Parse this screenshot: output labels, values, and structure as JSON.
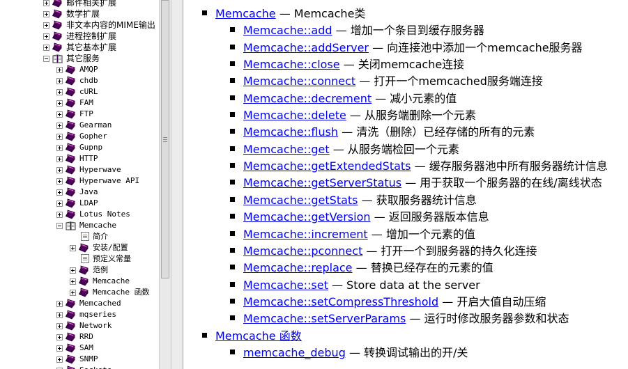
{
  "sidebar": {
    "items": [
      {
        "label": "邮件相关扩展",
        "expander": "plus",
        "icon": "book",
        "indent": 0
      },
      {
        "label": "数学扩展",
        "expander": "plus",
        "icon": "book",
        "indent": 0
      },
      {
        "label": "非文本内容的MIME输出",
        "expander": "plus",
        "icon": "book",
        "indent": 0
      },
      {
        "label": "进程控制扩展",
        "expander": "plus",
        "icon": "book",
        "indent": 0
      },
      {
        "label": "其它基本扩展",
        "expander": "plus",
        "icon": "book",
        "indent": 0
      },
      {
        "label": "其它服务",
        "expander": "minus",
        "icon": "book-open",
        "indent": 0
      },
      {
        "label": "AMQP",
        "expander": "plus",
        "icon": "book",
        "indent": 1
      },
      {
        "label": "chdb",
        "expander": "plus",
        "icon": "book",
        "indent": 1
      },
      {
        "label": "cURL",
        "expander": "plus",
        "icon": "book",
        "indent": 1
      },
      {
        "label": "FAM",
        "expander": "plus",
        "icon": "book",
        "indent": 1
      },
      {
        "label": "FTP",
        "expander": "plus",
        "icon": "book",
        "indent": 1
      },
      {
        "label": "Gearman",
        "expander": "plus",
        "icon": "book",
        "indent": 1
      },
      {
        "label": "Gopher",
        "expander": "plus",
        "icon": "book",
        "indent": 1
      },
      {
        "label": "Gupnp",
        "expander": "plus",
        "icon": "book",
        "indent": 1
      },
      {
        "label": "HTTP",
        "expander": "plus",
        "icon": "book",
        "indent": 1
      },
      {
        "label": "Hyperwave",
        "expander": "plus",
        "icon": "book",
        "indent": 1
      },
      {
        "label": "Hyperwave API",
        "expander": "plus",
        "icon": "book",
        "indent": 1
      },
      {
        "label": "Java",
        "expander": "plus",
        "icon": "book",
        "indent": 1
      },
      {
        "label": "LDAP",
        "expander": "plus",
        "icon": "book",
        "indent": 1
      },
      {
        "label": "Lotus Notes",
        "expander": "plus",
        "icon": "book",
        "indent": 1
      },
      {
        "label": "Memcache",
        "expander": "minus",
        "icon": "book-open",
        "indent": 1
      },
      {
        "label": "简介",
        "expander": "none",
        "icon": "page",
        "indent": 2
      },
      {
        "label": "安装/配置",
        "expander": "plus",
        "icon": "book",
        "indent": 2
      },
      {
        "label": "预定义常量",
        "expander": "none",
        "icon": "page",
        "indent": 2
      },
      {
        "label": "范例",
        "expander": "plus",
        "icon": "book",
        "indent": 2
      },
      {
        "label": "Memcache",
        "expander": "plus",
        "icon": "book",
        "indent": 2
      },
      {
        "label": "Memcache 函数",
        "expander": "plus",
        "icon": "book",
        "indent": 2
      },
      {
        "label": "Memcached",
        "expander": "plus",
        "icon": "book",
        "indent": 1
      },
      {
        "label": "mqseries",
        "expander": "plus",
        "icon": "book",
        "indent": 1
      },
      {
        "label": "Network",
        "expander": "plus",
        "icon": "book",
        "indent": 1
      },
      {
        "label": "RRD",
        "expander": "plus",
        "icon": "book",
        "indent": 1
      },
      {
        "label": "SAM",
        "expander": "plus",
        "icon": "book",
        "indent": 1
      },
      {
        "label": "SNMP",
        "expander": "plus",
        "icon": "book",
        "indent": 1
      },
      {
        "label": "Sockets",
        "expander": "plus",
        "icon": "book",
        "indent": 1
      }
    ]
  },
  "content": {
    "sections": [
      {
        "link": "Memcache",
        "desc": " — Memcache类",
        "items": [
          {
            "link": "Memcache::add",
            "desc": " — 增加一个条目到缓存服务器"
          },
          {
            "link": "Memcache::addServer",
            "desc": " — 向连接池中添加一个memcache服务器"
          },
          {
            "link": "Memcache::close",
            "desc": " — 关闭memcache连接"
          },
          {
            "link": "Memcache::connect",
            "desc": " — 打开一个memcached服务端连接"
          },
          {
            "link": "Memcache::decrement",
            "desc": " — 减小元素的值"
          },
          {
            "link": "Memcache::delete",
            "desc": " — 从服务端删除一个元素"
          },
          {
            "link": "Memcache::flush",
            "desc": " — 清洗（删除）已经存储的所有的元素"
          },
          {
            "link": "Memcache::get",
            "desc": " — 从服务端检回一个元素"
          },
          {
            "link": "Memcache::getExtendedStats",
            "desc": " — 缓存服务器池中所有服务器统计信息"
          },
          {
            "link": "Memcache::getServerStatus",
            "desc": " — 用于获取一个服务器的在线/离线状态"
          },
          {
            "link": "Memcache::getStats",
            "desc": " — 获取服务器统计信息"
          },
          {
            "link": "Memcache::getVersion",
            "desc": " — 返回服务器版本信息"
          },
          {
            "link": "Memcache::increment",
            "desc": " — 增加一个元素的值"
          },
          {
            "link": "Memcache::pconnect",
            "desc": " — 打开一个到服务器的持久化连接"
          },
          {
            "link": "Memcache::replace",
            "desc": " — 替换已经存在的元素的值"
          },
          {
            "link": "Memcache::set",
            "desc": " — Store data at the server"
          },
          {
            "link": "Memcache::setCompressThreshold",
            "desc": " — 开启大值自动压缩"
          },
          {
            "link": "Memcache::setServerParams",
            "desc": " — 运行时修改服务器参数和状态"
          }
        ]
      },
      {
        "link": "Memcache 函数",
        "desc": "",
        "items": [
          {
            "link": "memcache_debug",
            "desc": " — 转换调试输出的开/关"
          }
        ]
      }
    ]
  },
  "colors": {
    "link": "#0000ee",
    "book": "#800080",
    "book_dark": "#4b0060"
  }
}
